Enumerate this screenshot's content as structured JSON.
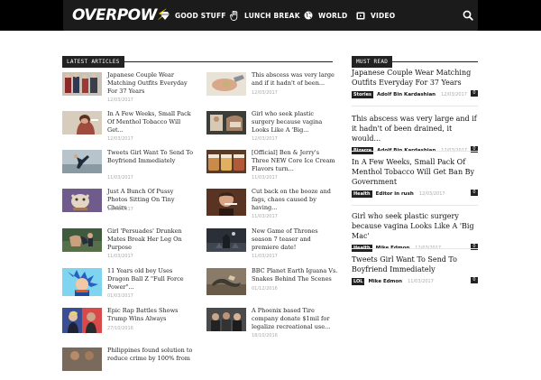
{
  "header": {
    "logo": "OVERPOW",
    "nav": [
      {
        "label": "GOOD STUFF",
        "icon": "diamond-icon"
      },
      {
        "label": "LUNCH BREAK",
        "icon": "hand-icon"
      },
      {
        "label": "WORLD",
        "icon": "globe-icon"
      },
      {
        "label": "VIDEO",
        "icon": "video-icon"
      }
    ]
  },
  "latest": {
    "heading": "LATEST ARTICLES",
    "left": [
      {
        "title": "Japanese Couple Wear Matching Outfits Everyday For 37 Years",
        "date": "12/03/2017"
      },
      {
        "title": "In A Few Weeks, Small Pack Of Menthol Tobacco Will Get...",
        "date": "12/03/2017"
      },
      {
        "title": "Tweets Girl Want To Send To Boyfriend Immediately",
        "date": "11/03/2017"
      },
      {
        "title": "Just A Bunch Of Pussy Photos Sitting On Tiny Chairs",
        "date": "11/03/2017"
      },
      {
        "title": "Girl 'Persuades' Drunken Mates Break Her Leg On Purpose",
        "date": "11/03/2017"
      },
      {
        "title": "11 Years old boy Uses Dragon Ball Z \"Full Force Power\"...",
        "date": "01/03/2017"
      },
      {
        "title": "Epic Rap Battles Shows Trump Wins Always",
        "date": "27/10/2016"
      },
      {
        "title": "Philippines found solution to reduce crime by 100% from",
        "date": ""
      }
    ],
    "right": [
      {
        "title": "This abscess was very large and if it hadn't of been...",
        "date": "12/03/2017"
      },
      {
        "title": "Girl who seek plastic surgery because vagina Looks Like A 'Big...",
        "date": "12/03/2017"
      },
      {
        "title": "[Official] Ben & Jerry's Three NEW Core Ice Cream Flavors turn...",
        "date": "11/03/2017"
      },
      {
        "title": "Cut back on the booze and fags, chaos caused by having...",
        "date": "11/03/2017"
      },
      {
        "title": "New Game of Thrones season 7 teaser and premiere date!",
        "date": "11/03/2017"
      },
      {
        "title": "BBC Planet Earth Iguana Vs. Snakes Behind The Scenes",
        "date": "01/12/2016"
      },
      {
        "title": "A Phoenix based Tire company donate $1mil for legalize recreational use...",
        "date": "18/10/2016"
      }
    ]
  },
  "must_read": {
    "heading": "MUST READ",
    "items": [
      {
        "title": "Japanese Couple Wear Matching Outfits Everyday For 37 Years",
        "category": "Stories",
        "author": "Adolf Bin Kardashian",
        "date": "12/03/2017",
        "comments": "0"
      },
      {
        "title": "This abscess was very large and if it hadn't of been drained, it would...",
        "category": "Bizarre",
        "author": "Adolf Bin Kardashian",
        "date": "12/03/2017",
        "comments": "0"
      },
      {
        "title": "In A Few Weeks, Small Pack Of Menthol Tobacco Will Get Ban By Government",
        "category": "Health",
        "author": "Editor in rush",
        "date": "12/03/2017",
        "comments": "0"
      },
      {
        "title": "Girl who seek plastic surgery because vagina Looks Like A 'Big Mac'",
        "category": "Health",
        "author": "Mike Edmon",
        "date": "12/03/2017",
        "comments": "0"
      },
      {
        "title": "Tweets Girl Want To Send To Boyfriend Immediately",
        "category": "LOL",
        "author": "Mike Edmon",
        "date": "11/03/2017",
        "comments": "0"
      }
    ]
  }
}
